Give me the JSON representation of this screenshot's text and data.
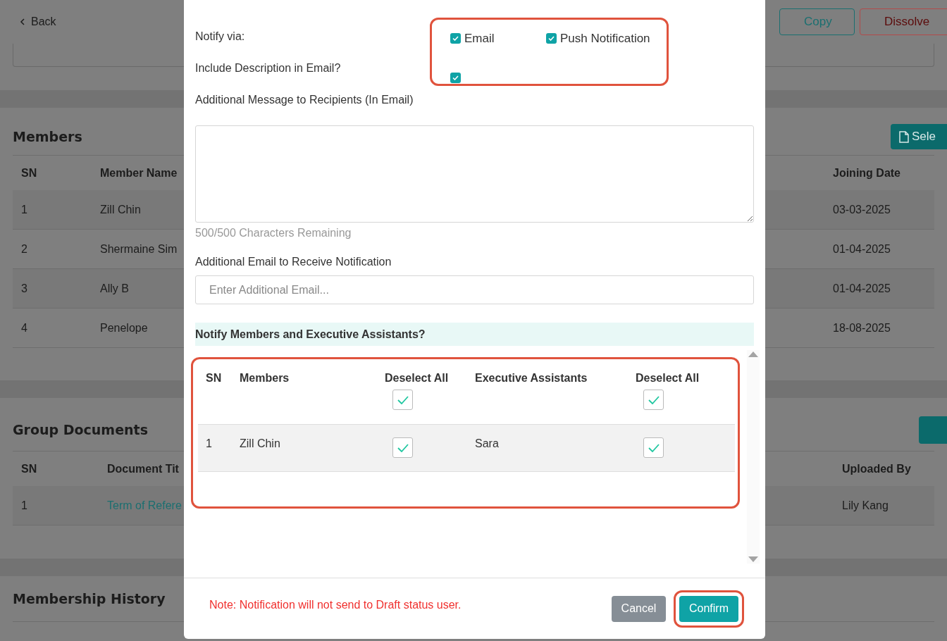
{
  "page": {
    "back": "Back",
    "actions": [
      {
        "label": "Copy",
        "kind": "outline-teal"
      },
      {
        "label": "Dissolve",
        "kind": "outline-red"
      }
    ],
    "members": {
      "title": "Members",
      "button": "Sele",
      "columns": [
        "SN",
        "Member Name",
        "Joining Date"
      ],
      "rows": [
        [
          "1",
          "Zill Chin",
          "03-03-2025"
        ],
        [
          "2",
          "Shermaine Sim",
          "01-04-2025"
        ],
        [
          "3",
          "Ally B",
          "01-04-2025"
        ],
        [
          "4",
          "Penelope",
          "18-08-2025"
        ]
      ]
    },
    "documents": {
      "title": "Group Documents",
      "columns": [
        "SN",
        "Document Tit",
        "Uploaded By"
      ],
      "rows": [
        [
          "1",
          "Term of Refere",
          "Lily Kang"
        ]
      ]
    },
    "history": {
      "title": "Membership History"
    }
  },
  "dialog": {
    "notify_label": "Notify via:",
    "channels": [
      {
        "label": "Email",
        "checked": true
      },
      {
        "label": "Push Notification",
        "checked": true
      }
    ],
    "include_label": "Include Description in Email?",
    "include_checked": true,
    "message_label": "Additional Message to Recipients (In Email)",
    "chars_remaining": "500/500 Characters Remaining",
    "email_label": "Additional Email to Receive Notification",
    "email_placeholder": "Enter Additional Email...",
    "section_title": "Notify Members and Executive Assistants?",
    "table": {
      "columns": [
        "SN",
        "Members",
        "Deselect All",
        "Executive Assistants",
        "Deselect All"
      ],
      "select_all_members": true,
      "select_all_assistants": true,
      "rows": [
        {
          "sn": "1",
          "member": "Zill Chin",
          "member_checked": true,
          "assistant": "Sara",
          "assistant_checked": true
        }
      ]
    },
    "note": "Note: Notification will not send to Draft status user.",
    "buttons": [
      {
        "label": "Cancel",
        "kind": "secondary"
      },
      {
        "label": "Confirm",
        "kind": "primary"
      }
    ]
  }
}
